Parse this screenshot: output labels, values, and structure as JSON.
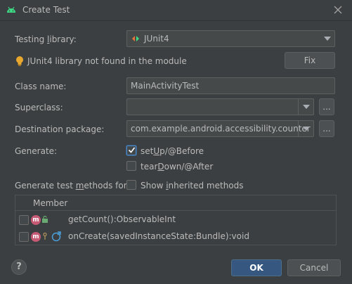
{
  "window": {
    "title": "Create Test"
  },
  "testing_library": {
    "label_pre": "Testing ",
    "label_u": "l",
    "label_post": "ibrary:",
    "value": "JUnit4"
  },
  "warning": {
    "text": "JUnit4 library not found in the module",
    "fix_label": "Fix"
  },
  "class_name": {
    "label": "Class name:",
    "value": "MainActivityTest"
  },
  "superclass": {
    "label": "Superclass:",
    "value": "",
    "browse_label": "..."
  },
  "destination": {
    "label": "Destination package:",
    "value": "com.example.android.accessibility.counter",
    "browse_label": "..."
  },
  "generate": {
    "label": "Generate:",
    "setup": {
      "pre": "set",
      "u": "U",
      "post": "p/@Before",
      "checked": true
    },
    "teardown": {
      "pre": "tear",
      "u": "D",
      "post": "own/@After",
      "checked": false
    }
  },
  "methods": {
    "label_pre": "Generate test ",
    "label_u": "m",
    "label_post": "ethods for:",
    "show_inherited": {
      "pre": "Show ",
      "u": "i",
      "post": "nherited methods",
      "checked": false
    }
  },
  "table": {
    "header": "Member",
    "rows": [
      {
        "icon": "m",
        "text": "getCount():ObservableInt"
      },
      {
        "icon": "m",
        "text": "onCreate(savedInstanceState:Bundle):void"
      }
    ]
  },
  "footer": {
    "help": "?",
    "ok": "OK",
    "cancel": "Cancel"
  },
  "colors": {
    "accent": "#365880",
    "warning": "#e8a82d",
    "method_icon": "#c45a74"
  }
}
